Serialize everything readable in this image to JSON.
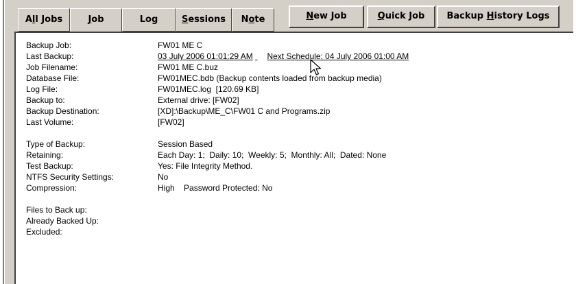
{
  "tabs": [
    {
      "label_pre": "A",
      "label_u": "l",
      "label_post": "l Jobs"
    },
    {
      "label_pre": "",
      "label_u": "J",
      "label_post": "ob"
    },
    {
      "label_pre": "Lo",
      "label_u": "g",
      "label_post": ""
    },
    {
      "label_pre": "",
      "label_u": "S",
      "label_post": "essions"
    },
    {
      "label_pre": "N",
      "label_u": "o",
      "label_post": "te"
    }
  ],
  "buttons": [
    {
      "label_pre": "",
      "label_u": "N",
      "label_post": "ew Job"
    },
    {
      "label_pre": "",
      "label_u": "Q",
      "label_post": "uick Job"
    },
    {
      "label_pre": "Backup ",
      "label_u": "H",
      "label_post": "istory Logs"
    }
  ],
  "details": {
    "backup_job": {
      "label": "Backup Job:",
      "value": "FW01 ME C"
    },
    "last_backup": {
      "label": "Last Backup:",
      "date": "03 July 2006 01:01:29 AM",
      "next": "Next Schedule: 04 July 2006 01:00 AM"
    },
    "job_filename": {
      "label": "Job Filename:",
      "value": "FW01 ME C.buz"
    },
    "database_file": {
      "label": "Database File:",
      "value": "FW01MEC.bdb (Backup contents loaded from backup media)"
    },
    "log_file": {
      "label": "Log File:",
      "value": "FW01MEC.log  [120.69 KB]"
    },
    "backup_to": {
      "label": "Backup to:",
      "value": "External drive: [FW02]"
    },
    "backup_destination": {
      "label": "Backup Destination:",
      "value": "[XD]:\\Backup\\ME_C\\FW01 C and Programs.zip"
    },
    "last_volume": {
      "label": "Last Volume:",
      "value": "[FW02]"
    },
    "type_of_backup": {
      "label": "Type of Backup:",
      "value": "Session Based"
    },
    "retaining": {
      "label": "Retaining:",
      "value": "Each Day: 1;  Daily: 10;  Weekly: 5;  Monthly: All;  Dated: None"
    },
    "test_backup": {
      "label": "Test Backup:",
      "value": "Yes: File Integrity Method."
    },
    "ntfs_security": {
      "label": "NTFS Security Settings:",
      "value": "No"
    },
    "compression": {
      "label": "Compression:",
      "value": "High    Password Protected: No"
    },
    "files_to_back_up": {
      "label": "Files to Back up:",
      "value": ""
    },
    "already_backed_up": {
      "label": "Already Backed Up:",
      "value": ""
    },
    "excluded": {
      "label": "Excluded:",
      "value": ""
    }
  },
  "icons": {
    "cursor": "mouse-pointer-icon"
  }
}
